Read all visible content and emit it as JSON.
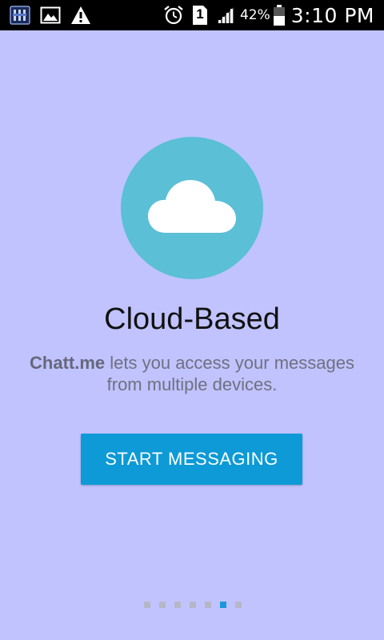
{
  "status_bar": {
    "left_icons": [
      "app-notification-icon",
      "image-icon",
      "warning-icon"
    ],
    "right_icons": [
      "alarm-icon",
      "sim-1-icon",
      "signal-icon"
    ],
    "sim_label": "1",
    "battery_percent": "42%",
    "time": "3:10 PM"
  },
  "onboarding": {
    "illustration_icon": "cloud-icon",
    "title": "Cloud-Based",
    "description_brand": "Chatt.me",
    "description_rest": " lets you access your messages from multiple devices.",
    "cta_label": "START MESSAGING"
  },
  "pager": {
    "total_pages": 7,
    "active_page": 6
  },
  "colors": {
    "background": "#c0c3fe",
    "illustration_circle": "#5bbfd6",
    "button": "#0d9ad7",
    "active_dot": "#1b97dc",
    "inactive_dot": "#b5b7c6"
  }
}
